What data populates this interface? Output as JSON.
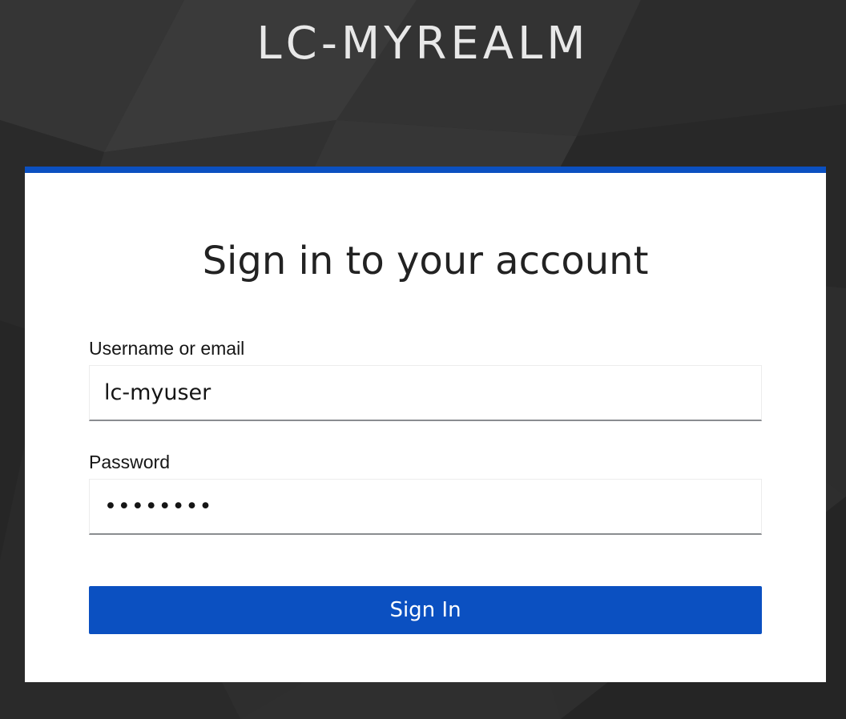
{
  "realm": {
    "title": "LC-MYREALM"
  },
  "login": {
    "heading": "Sign in to your account",
    "username_label": "Username or email",
    "username_value": "lc-myuser",
    "password_label": "Password",
    "password_value": "••••••••",
    "submit_label": "Sign In"
  },
  "colors": {
    "background": "#2b2b2b",
    "accent": "#0b50c1",
    "card": "#ffffff"
  }
}
